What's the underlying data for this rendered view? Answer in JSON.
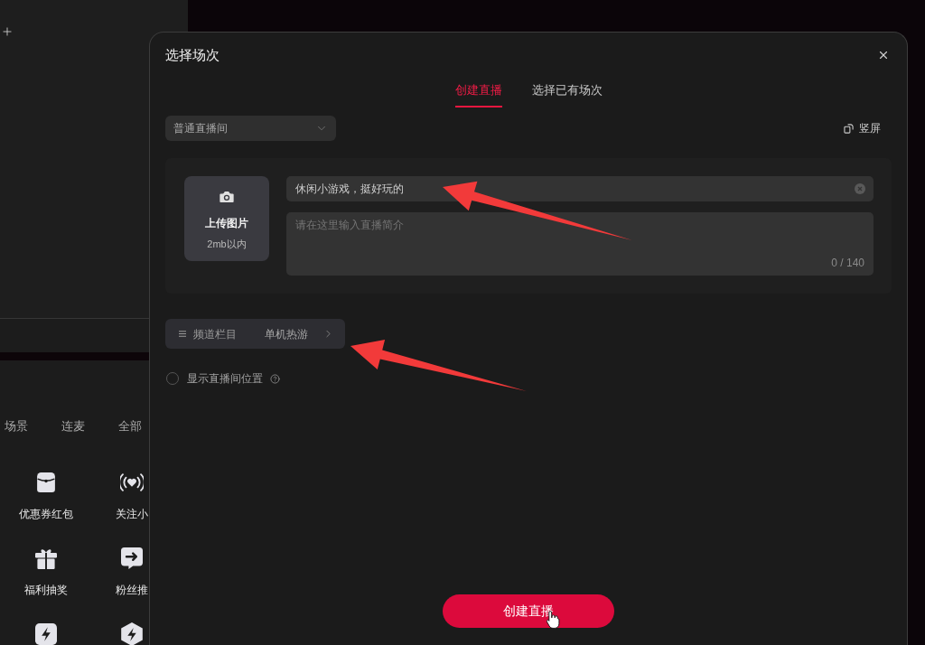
{
  "tools_panel": {
    "tabs": [
      "场景",
      "连麦",
      "全部"
    ],
    "tools": [
      {
        "kind": "coupon",
        "label": "优惠券红包"
      },
      {
        "kind": "broadcast",
        "label": "关注小"
      },
      {
        "kind": "gift",
        "label": "福利抽奖"
      },
      {
        "kind": "push",
        "label": "粉丝推"
      },
      {
        "kind": "flash"
      },
      {
        "kind": "flash_hex"
      }
    ]
  },
  "dialog": {
    "title": "选择场次",
    "tabs": [
      {
        "label": "创建直播",
        "selected": true
      },
      {
        "label": "选择已有场次",
        "selected": false
      }
    ],
    "room_type_select": {
      "value": "普通直播间"
    },
    "orientation_toggle": {
      "label": "竖屏"
    },
    "cover_upload": {
      "label": "上传图片",
      "hint": "2mb以内"
    },
    "title_field": {
      "value": "休闲小游戏，挺好玩的"
    },
    "intro_field": {
      "placeholder": "请在这里输入直播简介",
      "counter": "0 / 140"
    },
    "category": {
      "label": "频道栏目",
      "value": "单机热游"
    },
    "show_location": {
      "label": "显示直播间位置",
      "checked": false
    },
    "submit_button": {
      "label": "创建直播"
    }
  }
}
